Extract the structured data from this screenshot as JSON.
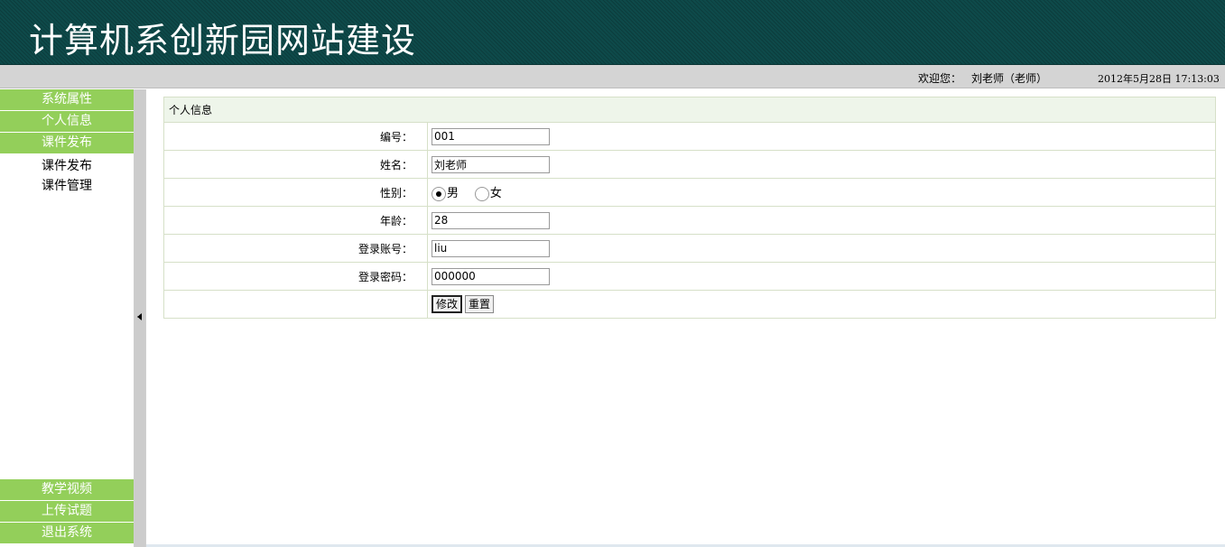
{
  "header": {
    "title": "计算机系创新园网站建设"
  },
  "topbar": {
    "welcome_label": "欢迎您：",
    "user": "刘老师（老师）",
    "datetime": "2012年5月28日  17:13:03"
  },
  "sidebar": {
    "groups_top": [
      {
        "label": "系统属性"
      },
      {
        "label": "个人信息"
      },
      {
        "label": "课件发布"
      }
    ],
    "sub_items": [
      {
        "label": "课件发布"
      },
      {
        "label": "课件管理"
      }
    ],
    "groups_bottom": [
      {
        "label": "教学视频"
      },
      {
        "label": "上传试题"
      },
      {
        "label": "退出系统"
      }
    ]
  },
  "form": {
    "caption": "个人信息",
    "fields": {
      "id": {
        "label": "编号：",
        "value": "001"
      },
      "name": {
        "label": "姓名：",
        "value": "刘老师"
      },
      "gender": {
        "label": "性别：",
        "options": [
          "男",
          "女"
        ],
        "selected": "男"
      },
      "age": {
        "label": "年龄：",
        "value": "28"
      },
      "account": {
        "label": "登录账号：",
        "value": "liu"
      },
      "password": {
        "label": "登录密码：",
        "value": "000000"
      }
    },
    "buttons": {
      "submit": "修改",
      "reset": "重置"
    }
  }
}
